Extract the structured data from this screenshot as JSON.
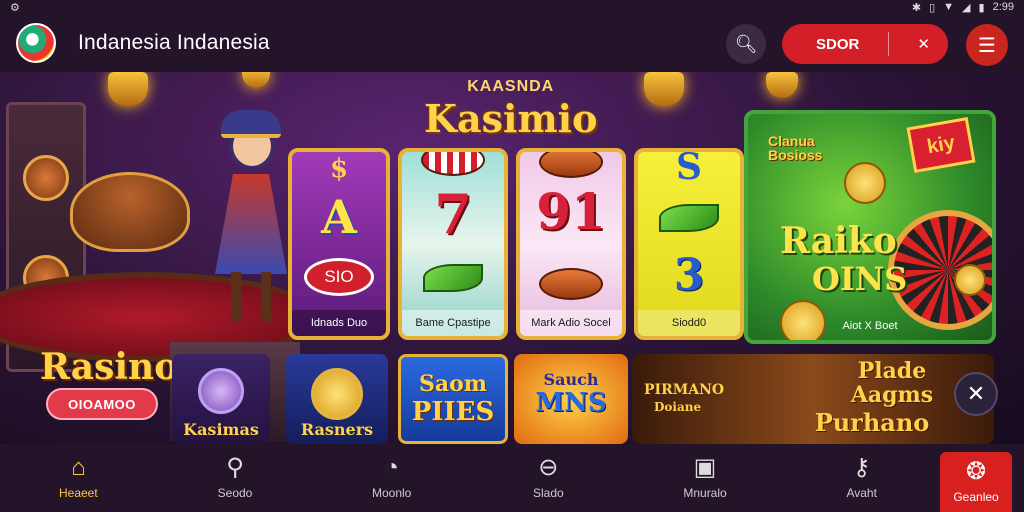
{
  "status_bar": {
    "left_icon": "settings-icon",
    "time": "2:99",
    "icons": [
      "bluetooth-icon",
      "vibrate-icon",
      "wifi-icon",
      "signal-icon",
      "battery-icon"
    ]
  },
  "header": {
    "title": "Indanesia Indanesia",
    "pill_label": "SDOR",
    "pill_icon": "shuffle-icon",
    "search_icon": "search-icon",
    "menu_icon": "menu-icon"
  },
  "banner": {
    "subtitle": "KAASNDA",
    "title": "Kasimio"
  },
  "hero": {
    "title": "Rasino",
    "button_label": "OIOAMOO"
  },
  "reels": [
    {
      "caption": "Idnads Duo",
      "symbol_top": "$",
      "symbol_mid": "A",
      "chip": "SIO"
    },
    {
      "caption": "Bame Cpastipe",
      "symbol_mid": "7"
    },
    {
      "caption": "Mark Adio Socel",
      "symbol_mid": "91"
    },
    {
      "caption": "Siodd0",
      "symbol_top": "S",
      "symbol_bottom": "3"
    }
  ],
  "promo": {
    "badge_line1": "Clanua",
    "badge_line2": "Bosioss",
    "ribbon": "kiy",
    "title_line1": "Raiko",
    "title_line2": "OINS",
    "caption": "Aiot X Boet"
  },
  "tiles": [
    {
      "label": "Kasimas"
    },
    {
      "label": "Rasners"
    },
    {
      "label_line1": "Saom",
      "label_line2": "PIIES"
    },
    {
      "label_line1": "Sauch",
      "label_line2": "MNS"
    },
    {
      "label_line1": "PIRMANO",
      "label_line2": "Doiane",
      "label_line3": "Plade",
      "label_line4": "Aagms",
      "label_line5": "Purhano"
    }
  ],
  "nav": [
    {
      "label": "Heaeet",
      "icon": "home-icon",
      "active": true
    },
    {
      "label": "Seodo",
      "icon": "search-icon"
    },
    {
      "label": "Moonlo",
      "icon": "history-icon"
    },
    {
      "label": "Slado",
      "icon": "slots-icon"
    },
    {
      "label": "Mnuralo",
      "icon": "gallery-icon"
    },
    {
      "label": "Avaht",
      "icon": "mic-icon"
    },
    {
      "label": "Geanleo",
      "icon": "gift-icon"
    }
  ],
  "colors": {
    "accent_red": "#d31f27",
    "gold": "#ffd24a",
    "bg": "#24142a"
  }
}
